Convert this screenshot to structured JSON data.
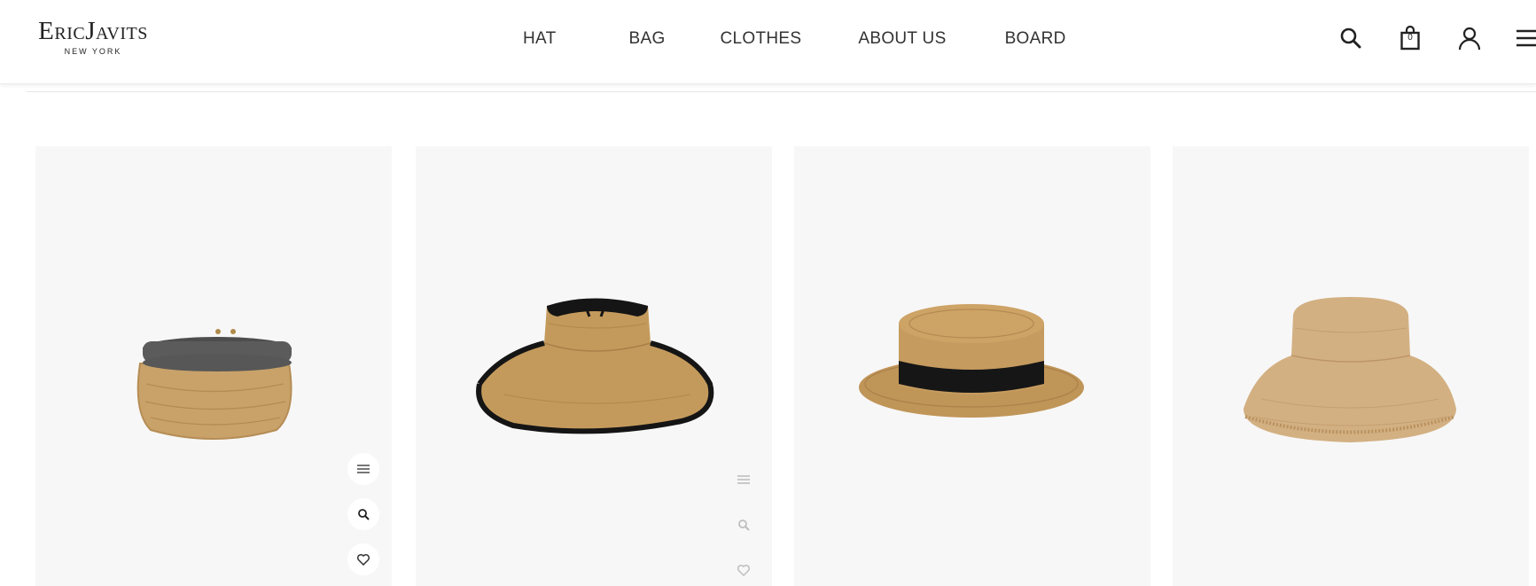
{
  "brand": {
    "name": "EricJavits",
    "sub": "NEW YORK"
  },
  "nav": {
    "items": [
      {
        "label": "HAT"
      },
      {
        "label": "BAG"
      },
      {
        "label": "CLOTHES"
      },
      {
        "label": "ABOUT US"
      },
      {
        "label": "BOARD"
      }
    ]
  },
  "header_icons": {
    "search": "search-icon",
    "cart": "shopping-bag-icon",
    "cart_count": "0",
    "account": "user-icon",
    "menu": "menu-icon"
  },
  "products": [
    {
      "image": "straw-visor-gray-band",
      "actions": [
        "menu-icon",
        "zoom-icon",
        "heart-icon"
      ]
    },
    {
      "image": "wide-brim-visor-black-trim"
    },
    {
      "image": "boater-hat-black-ribbon"
    },
    {
      "image": "fringed-bucket-hat"
    }
  ],
  "colors": {
    "card_bg": "#f7f7f7",
    "straw": "#c9a26a",
    "straw_dark": "#a57c45",
    "black_trim": "#151515",
    "gray_band": "#5b5b5b"
  }
}
